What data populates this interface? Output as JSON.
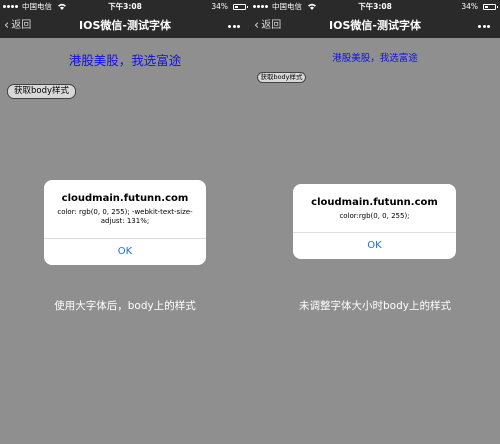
{
  "left": {
    "status": {
      "carrier": "中国电信",
      "time": "下午3:08",
      "battery_pct": "34%"
    },
    "nav": {
      "back_label": "返回",
      "title": "IOS微信-测试字体"
    },
    "headline": "港股美股，我选富途",
    "button_label": "获取body样式",
    "alert": {
      "title": "cloudmain.futunn.com",
      "message": "color: rgb(0, 0, 255); -webkit-text-size-adjust: 131%;",
      "ok_label": "OK"
    },
    "caption": "使用大字体后，body上的样式"
  },
  "right": {
    "status": {
      "carrier": "中国电信",
      "time": "下午3:08",
      "battery_pct": "34%"
    },
    "nav": {
      "back_label": "返回",
      "title": "IOS微信-测试字体"
    },
    "headline": "港股美股，我选富途",
    "button_label": "获取body样式",
    "alert": {
      "title": "cloudmain.futunn.com",
      "message": "color:rgb(0, 0, 255);",
      "ok_label": "OK"
    },
    "caption": "未调整字体大小时body上的样式"
  },
  "icons": {
    "back": "chevron-left-icon",
    "more": "more-dots-icon",
    "wifi": "wifi-icon",
    "battery": "battery-icon",
    "signal": "signal-icon"
  },
  "colors": {
    "overlay": "#8f8f8f",
    "bar": "#2a2a2a",
    "headline": "#1010e8",
    "ok": "#1a6fe0"
  }
}
